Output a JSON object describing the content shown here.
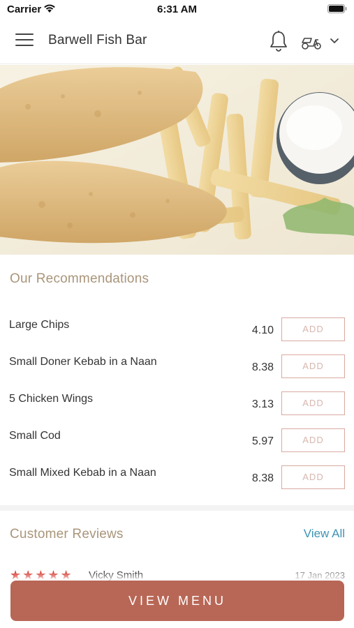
{
  "status_bar": {
    "carrier": "Carrier",
    "time": "6:31 AM"
  },
  "header": {
    "title": "Barwell Fish Bar",
    "icons": [
      "menu-icon",
      "bell-icon",
      "scooter-icon",
      "chevron-down-icon"
    ]
  },
  "recommendations": {
    "title": "Our Recommendations",
    "add_label": "ADD",
    "items": [
      {
        "name": "Large Chips",
        "price": "4.10"
      },
      {
        "name": "Small Doner Kebab in a Naan",
        "price": "8.38"
      },
      {
        "name": "5 Chicken Wings",
        "price": "3.13"
      },
      {
        "name": "Small Cod",
        "price": "5.97"
      },
      {
        "name": "Small Mixed Kebab in a Naan",
        "price": "8.38"
      }
    ]
  },
  "reviews": {
    "title": "Customer Reviews",
    "view_all": "View All",
    "first_review": {
      "stars": "★★★★★",
      "rating": 5,
      "name": "Vicky Smith",
      "date": "17 Jan 2023"
    }
  },
  "footer": {
    "view_menu_label": "VIEW MENU"
  },
  "colors": {
    "accent": "#b86756",
    "section_title": "#a9957a",
    "add_border": "#d9a9a0",
    "link": "#3e93b4",
    "star": "#d63b32"
  }
}
